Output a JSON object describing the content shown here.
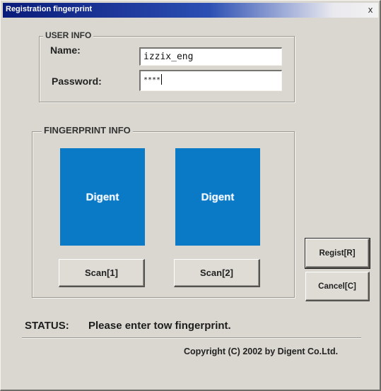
{
  "window": {
    "title": "Registration  fingerprint",
    "close_glyph": "x"
  },
  "user_info": {
    "group_title": "USER INFO",
    "name_label": "Name:",
    "name_value": "izzix_eng",
    "password_label": "Password:",
    "password_value": "****"
  },
  "fingerprint_info": {
    "group_title": "FINGERPRINT INFO",
    "panels": [
      {
        "logo": "Digent"
      },
      {
        "logo": "Digent"
      }
    ],
    "scan1_label": "Scan[1]",
    "scan2_label": "Scan[2]"
  },
  "actions": {
    "regist_label": "Regist[R]",
    "cancel_label": "Cancel[C]"
  },
  "status": {
    "label": "STATUS:",
    "message": "Please enter tow fingerprint."
  },
  "footer": {
    "copyright": "Copyright (C) 2002 by Digent Co.Ltd."
  },
  "colors": {
    "window_bg": "#d9d7d0",
    "titlebar_start": "#0a1c7a",
    "fingerprint_panel": "#0a79c6"
  }
}
